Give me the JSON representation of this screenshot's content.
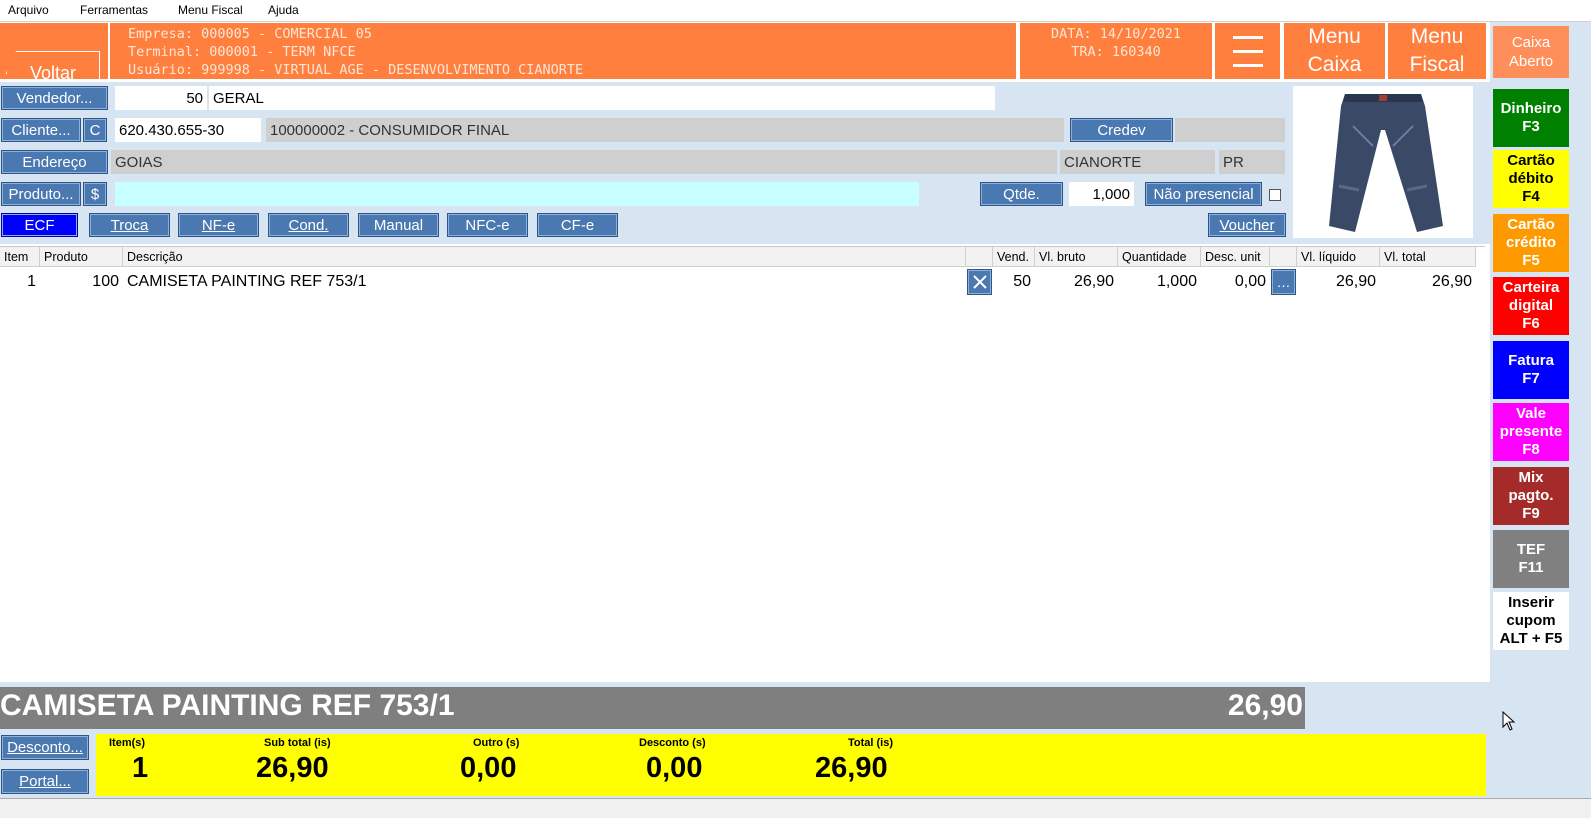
{
  "menubar": {
    "items": [
      "Arquivo",
      "Ferramentas",
      "Menu Fiscal",
      "Ajuda"
    ]
  },
  "header": {
    "back_label": "Voltar",
    "empresa": "Empresa: 000005 - COMERCIAL 05",
    "terminal": "Terminal: 000001 - TERM NFCE",
    "usuario": "Usuário: 999998 - VIRTUAL AGE - DESENVOLVIMENTO CIANORTE",
    "data": "DATA: 14/10/2021",
    "tra": "TRA: 160340",
    "menu_caixa_l1": "Menu",
    "menu_caixa_l2": "Caixa",
    "menu_fiscal_l1": "Menu",
    "menu_fiscal_l2": "Fiscal",
    "caixa_status_l1": "Caixa",
    "caixa_status_l2": "Aberto"
  },
  "form": {
    "vendedor_label": "Vendedor...",
    "vendedor_code": "50",
    "vendedor_name": "GERAL",
    "cliente_label": "Cliente...",
    "cliente_c": "C",
    "cliente_cpf": "620.430.655-30",
    "cliente_name": "100000002 - CONSUMIDOR FINAL",
    "credev_label": "Credev",
    "endereco_label": "Endereço",
    "endereco_value": "GOIAS",
    "cidade": "CIANORTE",
    "uf": "PR",
    "produto_label": "Produto...",
    "dollar": "$",
    "produto_value": "",
    "qtde_label": "Qtde.",
    "qtde_value": "1,000",
    "nao_presencial": "Não presencial",
    "voucher_label": "Voucher",
    "tabs": [
      "ECF",
      "Troca",
      "NF-e",
      "Cond.",
      "Manual",
      "NFC-e",
      "CF-e"
    ]
  },
  "grid": {
    "headers": [
      "Item",
      "Produto",
      "Descrição",
      "",
      "Vend.",
      "Vl. bruto",
      "Quantidade",
      "Desc. unit",
      "",
      "Vl. líquido",
      "Vl. total"
    ],
    "rows": [
      {
        "item": "1",
        "produto": "100",
        "descricao": "CAMISETA PAINTING REF 753/1",
        "vend": "50",
        "bruto": "26,90",
        "qtd": "1,000",
        "desc": "0,00",
        "liquido": "26,90",
        "total": "26,90"
      }
    ]
  },
  "payments": [
    {
      "l1": "Dinheiro",
      "l2": "F3",
      "color": "#008000",
      "text": "#ffffff"
    },
    {
      "l1": "Cartão",
      "l2": "débito",
      "l3": "F4",
      "color": "#ffff00",
      "text": "#000000"
    },
    {
      "l1": "Cartão",
      "l2": "crédito",
      "l3": "F5",
      "color": "#ff9900",
      "text": "#ffffff"
    },
    {
      "l1": "Carteira",
      "l2": "digital",
      "l3": "F6",
      "color": "#ff0000",
      "text": "#ffffff"
    },
    {
      "l1": "Fatura",
      "l2": "F7",
      "color": "#0000ff",
      "text": "#ffffff"
    },
    {
      "l1": "Vale",
      "l2": "presente",
      "l3": "F8",
      "color": "#ff00ff",
      "text": "#ffffff"
    },
    {
      "l1": "Mix",
      "l2": "pagto.",
      "l3": "F9",
      "color": "#a52a2a",
      "text": "#ffffff"
    },
    {
      "l1": "TEF",
      "l2": "F11",
      "color": "#808080",
      "text": "#ffffff"
    },
    {
      "l1": "Inserir",
      "l2": "cupom",
      "l3": "ALT + F5",
      "color": "#ffffff",
      "text": "#000000"
    }
  ],
  "summary": {
    "product_name": "CAMISETA PAINTING REF 753/1",
    "product_price": "26,90",
    "desconto_label": "Desconto...",
    "portal_label": "Portal...",
    "items_label": "Item(s)",
    "items_value": "1",
    "subtotal_label": "Sub total (is)",
    "subtotal_value": "26,90",
    "outro_label": "Outro (s)",
    "outro_value": "0,00",
    "desconto_t_label": "Desconto (s)",
    "desconto_t_value": "0,00",
    "total_label": "Total (is)",
    "total_value": "26,90"
  }
}
